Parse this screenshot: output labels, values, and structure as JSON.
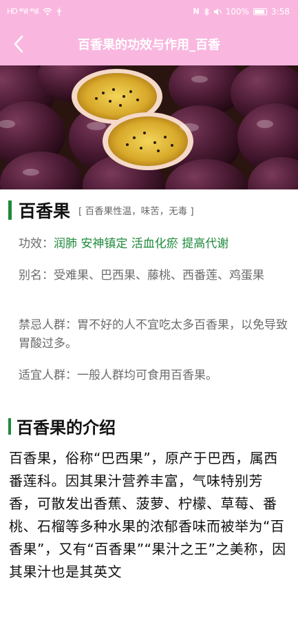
{
  "status_bar": {
    "left_icons": "HD ⁴⁶ıll ⁴⁶ıll",
    "battery": "100%",
    "time": "3:58"
  },
  "app_bar": {
    "title": "百香果的功效与作用_百香"
  },
  "fruit": {
    "name": "百香果",
    "subtitle": "[ 百香果性温，味苦，无毒 ]",
    "effects_label": "功效：",
    "effects_value": "润肺 安神镇定 活血化瘀 提高代谢",
    "alias_label": "别名：",
    "alias_value": "受难果、巴西果、藤桃、西番莲、鸡蛋果",
    "avoid_label": "禁忌人群：",
    "avoid_value": "胃不好的人不宜吃太多百香果，以免导致胃酸过多。",
    "suitable_label": "适宜人群：",
    "suitable_value": "一般人群均可食用百香果。"
  },
  "intro": {
    "title": "百香果的介绍",
    "text": "百香果，俗称“巴西果”，原产于巴西，属西番莲科。因其果汁营养丰富，气味特别芳香，可散发出香蕉、菠萝、柠檬、草莓、番桃、石榴等多种水果的浓郁香味而被举为“百香果”，又有“百香果”“果汁之王”之美称，因其果汁也是其英文"
  },
  "colors": {
    "pink_bar": "#f9b7df",
    "accent_green": "#1f8a3b"
  }
}
